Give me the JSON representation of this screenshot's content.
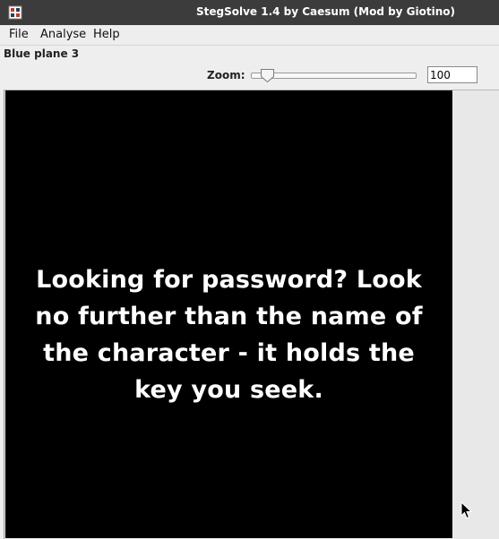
{
  "window": {
    "title": "StegSolve 1.4 by Caesum (Mod by Giotino)",
    "icon": "stegsolve-app-icon"
  },
  "menu": {
    "items": [
      {
        "label": "File"
      },
      {
        "label": "Analyse"
      },
      {
        "label": "Help"
      }
    ]
  },
  "plane": {
    "label": "Blue plane 3"
  },
  "zoom": {
    "label": "Zoom:",
    "value": "100",
    "slider_level": 0.06
  },
  "image": {
    "message": "Looking for password? Look no further than the name of the character - it holds the key you seek."
  },
  "colors": {
    "titlebar": "#3c3c3c",
    "background": "#eeeeee",
    "canvas": "#000000",
    "text": "#ffffff"
  }
}
